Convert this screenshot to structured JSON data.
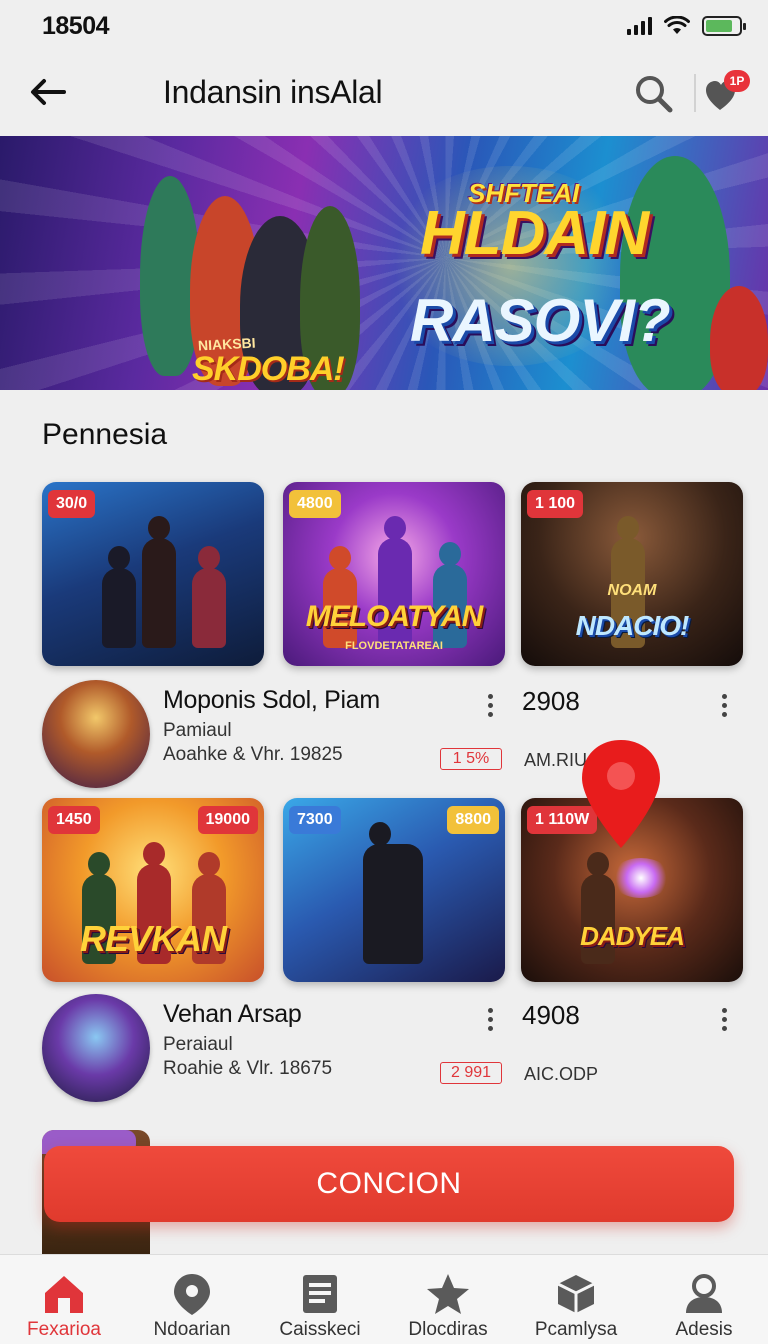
{
  "status_bar": {
    "time": "18504"
  },
  "header": {
    "title": "Indansin insAlal",
    "notification_count": "1P"
  },
  "hero": {
    "line_top": "SHFTEAI",
    "line_main": "HLDAIN",
    "line_sub": "RASOVI?",
    "left_small": "NIAKSBI",
    "left_main": "SKDOBA!"
  },
  "section": {
    "title": "Pennesia"
  },
  "cards_row1": [
    {
      "tag": "30/0",
      "title": "",
      "tag_color": "#e0353a"
    },
    {
      "tag": "4800",
      "title": "MELOATYAN",
      "subtitle": "FLOVDETATAREAI",
      "tag_color": "#f2c13a"
    },
    {
      "tag": "1 100",
      "title": "NDACIO!",
      "subtitle": "NOAM",
      "tag_color": "#e0353a"
    }
  ],
  "list_row1": {
    "title": "Moponis Sdol, Piam",
    "sub": "Pamiaul",
    "meta": "Aoahke & Vhr. 19825",
    "badge": "1 5%",
    "count": "2908",
    "foot": "AM.RIU"
  },
  "cards_row2": [
    {
      "tag": "1450",
      "tag_right": "19000",
      "title": "REVKAN",
      "tag_color": "#e0353a"
    },
    {
      "tag": "7300",
      "tag_right": "8800",
      "title": "",
      "tag_color": "#3a7ad8"
    },
    {
      "tag": "1 110W",
      "title": "DADYEA",
      "tag_color": "#e0353a"
    }
  ],
  "list_row2": {
    "title": "Vehan Arsap",
    "sub": "Peraiaul",
    "meta": "Roahie & Vlr. 18675",
    "badge": "2 991",
    "count": "4908",
    "foot": "AIC.ODP"
  },
  "cta": {
    "label": "CONCION"
  },
  "bottom_nav": [
    {
      "label": "Fexariоа",
      "icon": "home-icon",
      "active": true
    },
    {
      "label": "Ndoarian",
      "icon": "location-pin-icon",
      "active": false
    },
    {
      "label": "Caisskeci",
      "icon": "document-icon",
      "active": false
    },
    {
      "label": "Dlocdiras",
      "icon": "star-icon",
      "active": false
    },
    {
      "label": "Pcamlysa",
      "icon": "cube-icon",
      "active": false
    },
    {
      "label": "Adesis",
      "icon": "user-icon",
      "active": false
    }
  ],
  "colors": {
    "accent": "#e0353a",
    "background": "#efefef"
  }
}
